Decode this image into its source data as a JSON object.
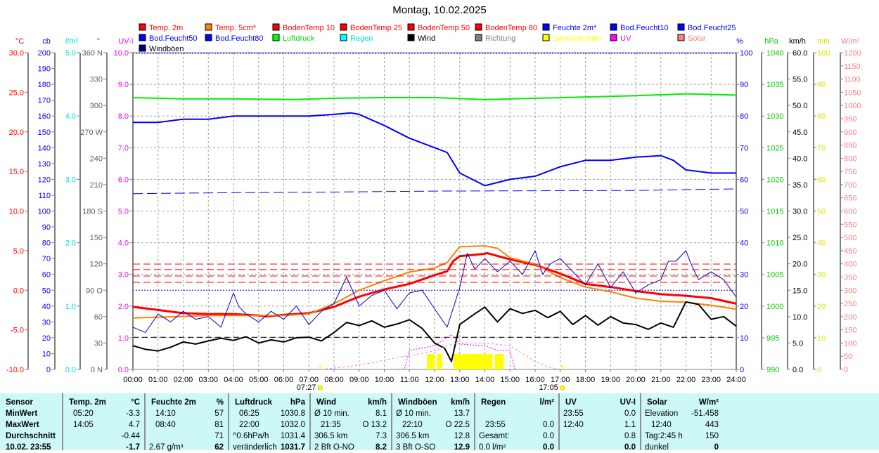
{
  "title": "Montag, 10.02.2025",
  "legend": [
    {
      "label": "Temp. 2m",
      "color": "#ff0000",
      "text": "#ff0000"
    },
    {
      "label": "Temp. 5cm*",
      "color": "#ff8000",
      "text": "#ff0000"
    },
    {
      "label": "BodenTemp 10",
      "color": "#ff0000",
      "text": "#ff0000"
    },
    {
      "label": "BodenTemp 25",
      "color": "#ff0000",
      "text": "#ff0000"
    },
    {
      "label": "BodenTemp 50",
      "color": "#ff0000",
      "text": "#ff0000"
    },
    {
      "label": "BodenTemp 80",
      "color": "#ff0000",
      "text": "#ff0000"
    },
    {
      "label": "Feuchte 2m*",
      "color": "#0000ff",
      "text": "#0000ff"
    },
    {
      "label": "Bod.Feucht10",
      "color": "#0000ff",
      "text": "#0000ff"
    },
    {
      "label": "Bod.Feucht25",
      "color": "#0000ff",
      "text": "#0000ff"
    },
    {
      "label": "Bod.Feucht50",
      "color": "#0000ff",
      "text": "#0000ff"
    },
    {
      "label": "Bod.Feucht80",
      "color": "#0000ff",
      "text": "#0000ff"
    },
    {
      "label": "Luftdruck",
      "color": "#00ff00",
      "text": "#00dd00"
    },
    {
      "label": "Regen",
      "color": "#00ffff",
      "text": "#00e0e0"
    },
    {
      "label": "Wind",
      "color": "#000000",
      "text": "#000000"
    },
    {
      "label": "Richtung",
      "color": "#808080",
      "text": "#808080"
    },
    {
      "label": "Sonnenschein",
      "color": "#ffff00",
      "text": "#ffff00"
    },
    {
      "label": "UV",
      "color": "#ff00ff",
      "text": "#ff00ff"
    },
    {
      "label": "Solar",
      "color": "#ff8080",
      "text": "#ff8080"
    },
    {
      "label": "Windböen",
      "color": "#000080",
      "text": "#000000"
    }
  ],
  "chart_data": {
    "type": "line",
    "title": "Montag, 10.02.2025",
    "x_ticks": [
      "00:00",
      "01:00",
      "02:00",
      "03:00",
      "04:00",
      "05:00",
      "06:00",
      "07:00",
      "08:00",
      "09:00",
      "10:00",
      "11:00",
      "12:00",
      "13:00",
      "14:00",
      "15:00",
      "16:00",
      "17:00",
      "18:00",
      "19:00",
      "20:00",
      "21:00",
      "22:00",
      "23:00",
      "24:00"
    ],
    "xlim_hours": [
      0,
      24
    ],
    "sunrise": "07:27",
    "sunset": "17:05",
    "axes_left": [
      {
        "unit": "°C",
        "color": "#ff0000",
        "range": [
          -10,
          30
        ],
        "step": 5,
        "decimals": 1
      },
      {
        "unit": "cb",
        "color": "#0000ff",
        "range": [
          0,
          200
        ],
        "step": 10,
        "decimals": 0
      },
      {
        "unit": "l/m²",
        "color": "#00e0e0",
        "range": [
          0,
          5
        ],
        "step": 1,
        "decimals": 1
      },
      {
        "unit": "°",
        "color": "#606060",
        "range": [
          0,
          360
        ],
        "step": 30,
        "decimals": 0,
        "names": {
          "0": "N",
          "90": "O",
          "180": "S",
          "270": "W",
          "360": "N"
        }
      },
      {
        "unit": "UV-I",
        "color": "#ff00ff",
        "range": [
          0,
          10
        ],
        "step": 1,
        "decimals": 1
      }
    ],
    "axes_right": [
      {
        "unit": "%",
        "color": "#0000ff",
        "range": [
          0,
          100
        ],
        "step": 10,
        "decimals": 0
      },
      {
        "unit": "hPa",
        "color": "#00cc00",
        "range": [
          990,
          1040
        ],
        "step": 5,
        "decimals": 0
      },
      {
        "unit": "km/h",
        "color": "#000000",
        "range": [
          0,
          60
        ],
        "step": 5,
        "decimals": 1
      },
      {
        "unit": "min",
        "color": "#e0e000",
        "range": [
          0,
          100
        ],
        "step": 10,
        "decimals": 0
      },
      {
        "unit": "W/m²",
        "color": "#ff8080",
        "range": [
          0,
          1200
        ],
        "step": 50,
        "decimals": 0
      }
    ],
    "series": [
      {
        "name": "Temp. 2m",
        "axis": "°C",
        "color": "#ff0000",
        "width": 3,
        "x": [
          0,
          1,
          2,
          3,
          4,
          5,
          5.33,
          6,
          7,
          8,
          9,
          10,
          11,
          12,
          12.5,
          12.75,
          13,
          14,
          14.08,
          15,
          16,
          17,
          18,
          19,
          20,
          21,
          22,
          23,
          24
        ],
        "y": [
          -2.1,
          -2.5,
          -2.9,
          -3.0,
          -3.0,
          -3.2,
          -3.3,
          -3.1,
          -2.9,
          -2.1,
          -0.8,
          0.1,
          0.8,
          1.9,
          2.4,
          3.7,
          4.3,
          4.6,
          4.7,
          3.9,
          3.2,
          2.1,
          0.8,
          0.4,
          -0.1,
          -0.5,
          -0.7,
          -1.0,
          -1.7
        ]
      },
      {
        "name": "Temp. 5cm*",
        "axis": "°C",
        "color": "#ff8000",
        "width": 2,
        "x": [
          0,
          1,
          2,
          3,
          4,
          5,
          6,
          7,
          8,
          9,
          10,
          11,
          12,
          12.5,
          13,
          14,
          14.5,
          15,
          16,
          17,
          18,
          19,
          20,
          21,
          22,
          23,
          24
        ],
        "y": [
          -3.5,
          -3.4,
          -3.3,
          -3.2,
          -3.2,
          -3.2,
          -3.2,
          -3.0,
          -1.7,
          0.0,
          1.2,
          2.3,
          2.8,
          3.5,
          5.5,
          5.6,
          5.3,
          4.1,
          3.3,
          1.6,
          0.4,
          -0.2,
          -1.0,
          -1.4,
          -1.5,
          -1.9,
          -2.4
        ]
      },
      {
        "name": "Feuchte 2m*",
        "axis": "%",
        "color": "#0000ff",
        "width": 2,
        "x": [
          0,
          1,
          1.5,
          2,
          3,
          4,
          5,
          6,
          7,
          8,
          8.67,
          9,
          10,
          11,
          12,
          12.5,
          13,
          14,
          15,
          16,
          17,
          18,
          19,
          20,
          21,
          21.5,
          22,
          23,
          24
        ],
        "y": [
          78,
          78,
          78.5,
          79,
          79,
          80,
          80,
          80,
          80,
          80.5,
          81,
          80.5,
          77,
          73,
          70,
          68.5,
          62,
          58,
          60,
          61,
          64,
          66,
          66,
          67,
          67.5,
          66,
          63,
          62,
          62
        ]
      },
      {
        "name": "Bod.Feucht10",
        "axis": "%",
        "color": "#0000ff",
        "width": 1,
        "dash": "14,6",
        "x": [
          0,
          4,
          8,
          12,
          16,
          20,
          24
        ],
        "y": [
          55.5,
          55.8,
          56,
          56.3,
          56.4,
          56.5,
          57
        ]
      },
      {
        "name": "Luftdruck",
        "axis": "hPa",
        "color": "#00ee00",
        "width": 2,
        "x": [
          0,
          2,
          4,
          6.42,
          8,
          10,
          12,
          14,
          16,
          18,
          20,
          22,
          24
        ],
        "y": [
          1032.9,
          1032.7,
          1032.7,
          1032.6,
          1032.8,
          1032.9,
          1032.9,
          1032.6,
          1032.8,
          1033.0,
          1033.2,
          1033.5,
          1033.3
        ]
      },
      {
        "name": "Wind",
        "axis": "km/h",
        "color": "#000000",
        "width": 2,
        "x": [
          0,
          0.5,
          1,
          1.5,
          2,
          2.5,
          3,
          3.5,
          4,
          4.5,
          5,
          5.5,
          6,
          6.5,
          7,
          7.5,
          8,
          8.5,
          9,
          9.5,
          10,
          10.5,
          11,
          11.5,
          12,
          12.4,
          12.67,
          13,
          13.5,
          14,
          14.5,
          15,
          15.5,
          16,
          16.5,
          17,
          17.5,
          18,
          18.5,
          19,
          19.5,
          20,
          20.5,
          21,
          21.5,
          22,
          22.5,
          23,
          23.5,
          24
        ],
        "y": [
          4.5,
          3.8,
          3.5,
          4.2,
          5.2,
          4.8,
          5.4,
          5.9,
          5.5,
          6.2,
          5.0,
          5.6,
          5.2,
          6.0,
          6.1,
          5.4,
          7.0,
          8.9,
          8.3,
          9.2,
          8.0,
          8.6,
          9.4,
          7.8,
          5.0,
          4.0,
          1.5,
          8.5,
          10.2,
          11.8,
          9.0,
          11.5,
          10.6,
          11.2,
          9.8,
          11.0,
          8.5,
          10.2,
          8.4,
          10.0,
          8.8,
          8.5,
          7.6,
          8.8,
          8.0,
          12.8,
          12.3,
          9.5,
          10.0,
          8.2
        ]
      },
      {
        "name": "Windböen",
        "axis": "km/h",
        "color": "#0000cc",
        "width": 1,
        "x": [
          0,
          0.5,
          1,
          1.5,
          2,
          2.5,
          3,
          3.5,
          4,
          4.2,
          4.5,
          5,
          5.5,
          6,
          6.5,
          7,
          7.5,
          8,
          8.5,
          9,
          9.5,
          10,
          10.5,
          11,
          11.5,
          12,
          12.5,
          13,
          13.3,
          13.6,
          14,
          14.5,
          15,
          15.5,
          16,
          16.3,
          16.6,
          17,
          17.5,
          18,
          18.5,
          19,
          19.5,
          20,
          20.5,
          21,
          21.3,
          21.6,
          22,
          22.2,
          22.5,
          23,
          23.5,
          24
        ],
        "y": [
          8,
          7,
          10.5,
          9,
          11,
          9.5,
          10,
          8,
          14.5,
          12,
          10.5,
          9,
          11,
          9.5,
          12,
          8.5,
          11,
          12.5,
          17.5,
          12,
          14,
          15,
          11.5,
          14.5,
          15,
          11.5,
          8,
          15.5,
          22,
          19,
          21,
          18.5,
          20.5,
          18,
          22.5,
          18,
          20,
          21,
          18.5,
          16,
          20,
          15.5,
          18.5,
          14.5,
          16,
          17,
          20.5,
          20.5,
          22.5,
          20,
          17,
          18.5,
          17,
          13.7
        ]
      },
      {
        "name": "BodenTemp 10",
        "axis": "°C",
        "color": "#ff0000",
        "width": 1,
        "dash": "10,5",
        "x": [
          0,
          24
        ],
        "y": [
          3.3,
          3.3
        ]
      },
      {
        "name": "BodenTemp 25",
        "axis": "°C",
        "color": "#ff0000",
        "width": 1,
        "dash": "10,5",
        "x": [
          0,
          24
        ],
        "y": [
          2.6,
          2.6
        ]
      },
      {
        "name": "BodenTemp 50",
        "axis": "°C",
        "color": "#ff0000",
        "width": 1,
        "dash": "10,5",
        "x": [
          0,
          24
        ],
        "y": [
          1.8,
          1.8
        ]
      },
      {
        "name": "BodenTemp 80",
        "axis": "°C",
        "color": "#ff0000",
        "width": 1,
        "dash": "10,5",
        "x": [
          0,
          24
        ],
        "y": [
          1.0,
          1.0
        ]
      },
      {
        "name": "Solar",
        "axis": "W/m²",
        "color": "#ff80c0",
        "width": 1,
        "dash": "3,3",
        "x": [
          7.5,
          8.5,
          9.5,
          10.5,
          11.5,
          12,
          12.67,
          13,
          14,
          14.5,
          15,
          15.5,
          16,
          16.5,
          17
        ],
        "y": [
          0,
          10,
          25,
          45,
          60,
          70,
          95,
          100,
          100,
          95,
          90,
          60,
          30,
          10,
          0
        ]
      },
      {
        "name": "UV",
        "axis": "UV-I",
        "color": "#ff00ff",
        "width": 1,
        "dash": "2,2",
        "x": [
          10.5,
          10.8,
          11,
          12,
          12.67,
          13,
          14,
          14.5,
          15,
          15.2
        ],
        "y": [
          0,
          0,
          0.6,
          0.75,
          1.1,
          0.8,
          0.75,
          0.6,
          0.6,
          0
        ]
      }
    ],
    "sunshine": {
      "axis": "min",
      "color": "#ffff00",
      "x": [
        11.75,
        11.95,
        12.05,
        12.25,
        12.5,
        13.0,
        13.5,
        14.0,
        14.5,
        14.75
      ],
      "y": [
        5,
        5,
        5,
        5,
        5,
        5,
        5,
        5,
        5,
        5
      ],
      "intervals": [
        [
          11.7,
          12.0
        ],
        [
          12.1,
          12.3
        ],
        [
          12.75,
          14.3
        ],
        [
          14.4,
          14.75
        ]
      ]
    }
  },
  "table": {
    "columns": [
      {
        "head": "Sensor",
        "unit": "",
        "rows": [
          [
            "MinWert",
            ""
          ],
          [
            "MaxWert",
            ""
          ],
          [
            "Durchschnitt",
            ""
          ],
          [
            "10.02. 23:55",
            ""
          ]
        ],
        "labelbold": true
      },
      {
        "head": "Temp. 2m",
        "unit": "°C",
        "rows": [
          [
            "05:20",
            "-3.3"
          ],
          [
            "14:05",
            "4.7"
          ],
          [
            "",
            "-0.44"
          ],
          [
            "",
            "-1.7"
          ]
        ]
      },
      {
        "head": "Feuchte 2m",
        "unit": "%",
        "rows": [
          [
            "14:10",
            "57"
          ],
          [
            "08:40",
            "81"
          ],
          [
            "",
            "71"
          ],
          [
            "2.67 g/m³",
            "62"
          ]
        ]
      },
      {
        "head": "Luftdruck",
        "unit": "hPa",
        "rows": [
          [
            "06:25",
            "1030.8"
          ],
          [
            "22:00",
            "1032.0"
          ],
          [
            "^0.6hPa/h",
            "1031.4"
          ],
          [
            "veränderlich",
            "1031.7"
          ]
        ]
      },
      {
        "head": "Wind",
        "unit": "km/h",
        "rows": [
          [
            "Ø 10 min.",
            "8.1"
          ],
          [
            "21:35",
            "O 13.2"
          ],
          [
            "306.5 km",
            "7.3"
          ],
          [
            "2 Bft O-NO",
            "8.2"
          ]
        ]
      },
      {
        "head": "Windböen",
        "unit": "km/h",
        "rows": [
          [
            "Ø 10 min.",
            "13.7"
          ],
          [
            "22:10",
            "O 22.5"
          ],
          [
            "306.5 km",
            "12.8"
          ],
          [
            "3 Bft O-SO",
            "12.9"
          ]
        ]
      },
      {
        "head": "Regen",
        "unit": "l/m²",
        "rows": [
          [
            "",
            ""
          ],
          [
            "23:55",
            "0.0"
          ],
          [
            "Gesamt:",
            "0.0"
          ],
          [
            "0.0 l/m²",
            "0.0"
          ]
        ]
      },
      {
        "head": "UV",
        "unit": "UV-I",
        "rows": [
          [
            "23:55",
            "0.0"
          ],
          [
            "12:40",
            "1.1"
          ],
          [
            "",
            "0.8"
          ],
          [
            "",
            "0.0"
          ]
        ]
      },
      {
        "head": "Solar",
        "unit": "W/m²",
        "rows": [
          [
            "Elevation",
            "-51.458"
          ],
          [
            "12:40",
            "443"
          ],
          [
            "Tag:2:45 h",
            "150"
          ],
          [
            "dunkel",
            "0"
          ]
        ]
      }
    ]
  }
}
